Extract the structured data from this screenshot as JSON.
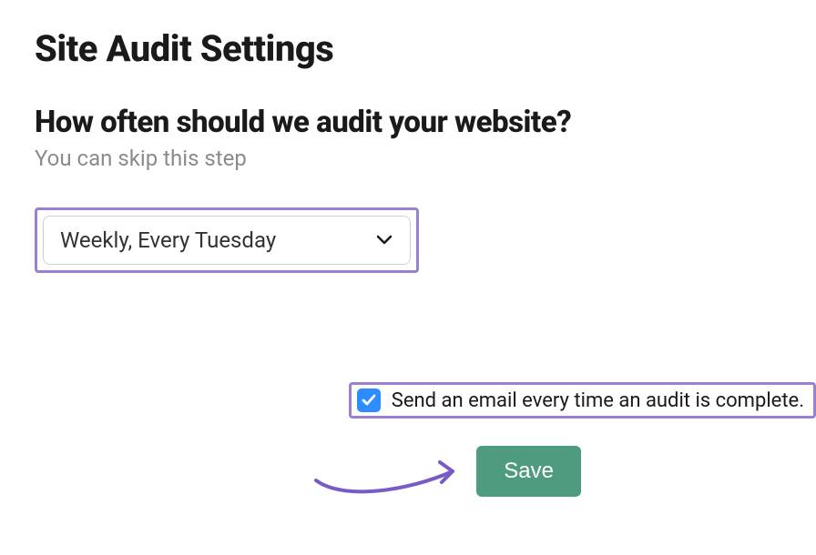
{
  "page": {
    "title": "Site Audit Settings"
  },
  "schedule": {
    "heading": "How often should we audit your website?",
    "subtext": "You can skip this step",
    "selected": "Weekly, Every Tuesday"
  },
  "email_option": {
    "label": "Send an email every time an audit is complete.",
    "checked": true
  },
  "actions": {
    "save_label": "Save"
  },
  "highlight_color": "#9b7fd4",
  "accent_arrow_color": "#7a5bc6"
}
